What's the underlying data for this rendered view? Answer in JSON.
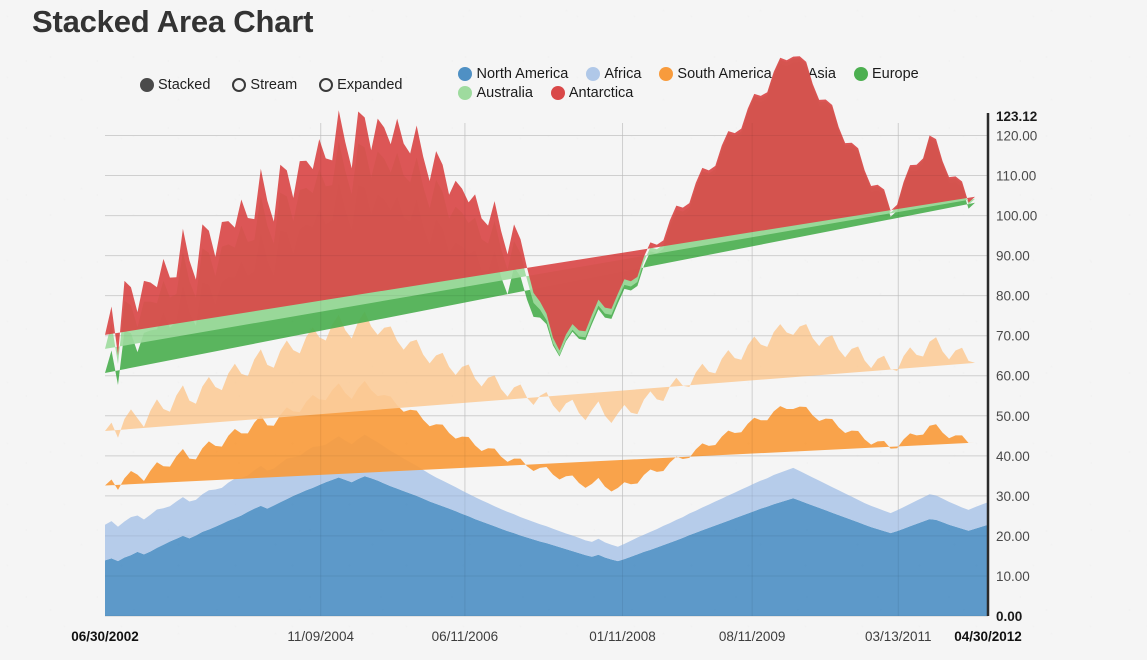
{
  "title": "Stacked Area Chart",
  "controls": {
    "modes": [
      {
        "label": "Stacked",
        "selected": true
      },
      {
        "label": "Stream",
        "selected": false
      },
      {
        "label": "Expanded",
        "selected": false
      }
    ]
  },
  "colors": {
    "background": "#f5f5f5",
    "title": "#333333",
    "gridline": "#dcdcdc",
    "axis": "#2b2b2b",
    "radio_on": "#4a4a4a"
  },
  "chart_data": {
    "type": "area",
    "stacked": true,
    "title": "Stacked Area Chart",
    "xlabel": "",
    "ylabel": "",
    "grid": true,
    "legend_position": "top",
    "ylim": [
      0,
      123.12
    ],
    "yticks": [
      "0.00",
      "10.00",
      "20.00",
      "30.00",
      "40.00",
      "50.00",
      "60.00",
      "70.00",
      "80.00",
      "90.00",
      "100.00",
      "110.00",
      "120.00"
    ],
    "ytick_values": [
      0,
      10,
      20,
      30,
      40,
      50,
      60,
      70,
      80,
      90,
      100,
      110,
      120
    ],
    "ymax_label": "123.12",
    "ymin_label": "0.00",
    "xticks": [
      "06/30/2002",
      "11/09/2004",
      "06/11/2006",
      "01/11/2008",
      "08/11/2009",
      "03/13/2011",
      "04/30/2012"
    ],
    "xtick_positions": [
      0,
      0.2443,
      0.4076,
      0.5861,
      0.7329,
      0.8984,
      1.0
    ],
    "series": [
      {
        "name": "North America",
        "color": "#4f90c4",
        "values": [
          13.9,
          14.4,
          13.7,
          14.6,
          15.2,
          16.0,
          15.4,
          16.1,
          17.0,
          17.8,
          18.6,
          19.3,
          20.0,
          19.4,
          20.1,
          21.0,
          21.6,
          22.3,
          23.0,
          23.8,
          24.4,
          25.1,
          26.0,
          26.8,
          27.5,
          26.8,
          27.6,
          28.4,
          29.2,
          30.0,
          30.7,
          31.4,
          32.0,
          32.7,
          33.4,
          34.0,
          34.6,
          34.0,
          33.4,
          34.2,
          34.9,
          34.4,
          33.8,
          33.1,
          32.4,
          31.8,
          31.2,
          30.6,
          30.0,
          29.3,
          28.6,
          28.0,
          27.4,
          26.8,
          26.2,
          25.5,
          24.9,
          24.2,
          23.6,
          23.0,
          22.4,
          21.8,
          21.2,
          20.7,
          20.1,
          19.6,
          19.1,
          18.6,
          18.2,
          17.7,
          17.2,
          16.7,
          16.2,
          15.7,
          15.2,
          14.8,
          15.3,
          14.6,
          14.1,
          13.7,
          14.2,
          14.8,
          15.4,
          16.0,
          16.5,
          17.1,
          17.7,
          18.3,
          18.9,
          19.5,
          20.2,
          20.8,
          21.4,
          22.0,
          22.6,
          23.2,
          23.8,
          24.4,
          25.0,
          25.6,
          26.2,
          26.8,
          27.3,
          27.9,
          28.4,
          28.9,
          29.4,
          28.8,
          28.2,
          27.6,
          27.0,
          26.4,
          25.8,
          25.2,
          24.6,
          24.0,
          23.4,
          22.8,
          22.2,
          21.7,
          21.2,
          20.7,
          21.2,
          21.8,
          22.4,
          23.0,
          23.6,
          24.2,
          24.0,
          23.4,
          22.8,
          22.3,
          21.8,
          21.3,
          21.8,
          22.3,
          22.8
        ]
      },
      {
        "name": "Africa",
        "color": "#b0c8e8",
        "values": [
          8.9,
          9.3,
          8.6,
          9.0,
          9.5,
          9.1,
          8.7,
          9.2,
          9.6,
          9.1,
          8.8,
          9.3,
          9.7,
          9.2,
          8.9,
          9.4,
          9.8,
          9.3,
          9.0,
          9.5,
          9.9,
          9.4,
          9.1,
          9.6,
          10.0,
          9.5,
          9.2,
          9.7,
          10.1,
          9.6,
          9.3,
          9.8,
          10.2,
          9.7,
          9.4,
          9.9,
          10.3,
          9.8,
          9.5,
          10.0,
          10.4,
          9.9,
          9.6,
          9.2,
          8.8,
          8.5,
          8.1,
          7.8,
          7.5,
          7.2,
          6.9,
          6.6,
          6.4,
          6.2,
          6.0,
          5.8,
          5.6,
          5.5,
          5.3,
          5.2,
          5.0,
          4.9,
          4.8,
          4.7,
          4.6,
          4.5,
          4.4,
          4.3,
          4.2,
          4.1,
          4.0,
          3.9,
          3.9,
          3.8,
          3.7,
          3.7,
          4.0,
          3.8,
          3.7,
          3.6,
          3.8,
          4.0,
          4.2,
          4.3,
          4.5,
          4.6,
          4.8,
          4.9,
          5.1,
          5.2,
          5.4,
          5.5,
          5.7,
          5.8,
          6.0,
          6.1,
          6.3,
          6.4,
          6.6,
          6.7,
          6.9,
          7.0,
          7.1,
          7.3,
          7.4,
          7.5,
          7.6,
          7.4,
          7.2,
          7.0,
          6.8,
          6.6,
          6.4,
          6.2,
          6.0,
          5.8,
          5.6,
          5.4,
          5.3,
          5.2,
          5.1,
          5.0,
          5.2,
          5.4,
          5.6,
          5.8,
          6.0,
          6.2,
          6.1,
          5.9,
          5.7,
          5.5,
          5.3,
          5.2,
          5.4,
          5.5,
          5.6
        ]
      },
      {
        "name": "South America",
        "color": "#f89b3c",
        "values": [
          9.8,
          10.4,
          9.2,
          10.8,
          11.5,
          10.2,
          9.6,
          11.0,
          11.8,
          10.5,
          9.9,
          11.3,
          12.0,
          10.7,
          10.1,
          11.5,
          12.2,
          10.9,
          10.3,
          11.7,
          12.4,
          11.1,
          10.5,
          11.9,
          12.6,
          11.3,
          10.7,
          12.1,
          12.8,
          11.5,
          10.9,
          12.3,
          13.0,
          11.7,
          11.1,
          12.5,
          13.2,
          11.9,
          11.3,
          12.7,
          13.4,
          12.1,
          11.5,
          12.9,
          13.6,
          12.3,
          11.7,
          13.1,
          13.8,
          12.5,
          11.9,
          13.3,
          14.0,
          12.7,
          12.1,
          13.5,
          14.2,
          12.9,
          12.3,
          13.7,
          14.4,
          13.1,
          12.5,
          13.9,
          14.6,
          13.3,
          12.7,
          14.1,
          14.8,
          13.5,
          12.9,
          14.3,
          15.0,
          13.7,
          13.1,
          14.5,
          15.2,
          13.9,
          13.3,
          14.7,
          15.4,
          14.1,
          13.5,
          14.9,
          15.6,
          14.3,
          13.7,
          15.1,
          15.8,
          14.5,
          13.9,
          15.3,
          16.0,
          14.7,
          14.1,
          15.5,
          16.2,
          14.9,
          14.3,
          15.7,
          16.4,
          15.1,
          14.5,
          15.9,
          16.6,
          15.3,
          14.7,
          16.1,
          16.8,
          15.5,
          14.9,
          16.3,
          17.0,
          15.7,
          15.1,
          16.5,
          17.2,
          15.9,
          15.3,
          16.7,
          17.4,
          16.1,
          15.5,
          16.9,
          17.6,
          16.3,
          15.7,
          17.1,
          17.8,
          16.5,
          15.9,
          17.3,
          18.0,
          16.7,
          16.1
        ]
      },
      {
        "name": "Asia",
        "color": "#fbcc9a",
        "values": [
          13.6,
          14.2,
          13.0,
          14.8,
          15.4,
          14.1,
          13.5,
          15.0,
          15.7,
          14.3,
          13.7,
          15.2,
          15.9,
          14.5,
          13.9,
          15.4,
          16.1,
          14.7,
          14.1,
          15.6,
          16.3,
          14.9,
          14.3,
          15.8,
          16.5,
          15.1,
          14.5,
          16.0,
          16.7,
          15.3,
          14.7,
          16.2,
          16.9,
          15.5,
          14.9,
          16.4,
          17.1,
          15.7,
          15.1,
          16.6,
          17.3,
          15.9,
          15.3,
          16.8,
          17.5,
          16.1,
          15.5,
          17.0,
          17.7,
          16.3,
          15.7,
          17.2,
          17.9,
          16.5,
          15.9,
          17.4,
          18.1,
          16.7,
          16.1,
          17.6,
          18.3,
          16.9,
          16.3,
          17.8,
          18.5,
          17.1,
          16.5,
          18.0,
          18.7,
          17.3,
          16.7,
          18.2,
          18.9,
          17.5,
          16.9,
          18.4,
          19.1,
          17.7,
          17.1,
          18.6,
          19.3,
          17.9,
          17.3,
          18.8,
          19.5,
          18.1,
          17.5,
          19.0,
          19.7,
          18.3,
          17.7,
          19.2,
          19.9,
          18.5,
          17.9,
          19.4,
          20.1,
          18.7,
          18.1,
          19.6,
          20.3,
          18.9,
          18.3,
          19.8,
          20.5,
          19.1,
          18.5,
          20.0,
          20.7,
          19.3,
          18.7,
          20.2,
          20.9,
          19.5,
          18.9,
          20.4,
          21.1,
          19.7,
          19.1,
          20.6,
          21.3,
          19.9,
          19.3,
          20.8,
          21.5,
          20.1,
          19.5,
          21.0,
          21.7,
          20.3,
          19.7,
          21.2,
          21.9,
          20.5,
          19.9
        ]
      },
      {
        "name": "Europe",
        "color": "#4caf50",
        "values": [
          14.5,
          18.0,
          13.2,
          22.0,
          19.0,
          16.5,
          23.5,
          20.0,
          17.5,
          24.0,
          21.0,
          18.5,
          25.0,
          22.0,
          19.5,
          26.0,
          23.0,
          20.5,
          27.0,
          24.0,
          21.5,
          28.0,
          25.0,
          22.0,
          29.0,
          26.0,
          23.0,
          30.0,
          27.0,
          24.0,
          31.0,
          28.0,
          25.0,
          32.0,
          29.0,
          26.0,
          33.0,
          30.0,
          27.0,
          34.0,
          31.0,
          28.0,
          35.0,
          32.0,
          29.0,
          36.0,
          33.0,
          30.0,
          35.0,
          32.0,
          29.5,
          34.0,
          31.0,
          28.5,
          33.0,
          30.0,
          27.5,
          32.0,
          29.0,
          26.5,
          31.0,
          28.0,
          25.5,
          30.0,
          27.0,
          24.5,
          22.0,
          19.5,
          17.0,
          15.0,
          14.0,
          15.5,
          17.0,
          18.5,
          20.0,
          21.5,
          23.0,
          24.5,
          26.0,
          27.5,
          29.0,
          30.5,
          32.0,
          33.5,
          35.0,
          36.5,
          38.0,
          39.5,
          41.0,
          42.5,
          44.0,
          45.5,
          47.0,
          48.5,
          50.0,
          51.5,
          53.0,
          54.5,
          56.0,
          57.5,
          59.0,
          60.5,
          62.0,
          63.5,
          65.0,
          66.5,
          68.0,
          66.0,
          64.0,
          62.0,
          60.0,
          58.0,
          56.0,
          54.0,
          52.0,
          50.0,
          48.0,
          46.0,
          44.0,
          42.0,
          40.0,
          38.0,
          40.0,
          42.0,
          44.0,
          46.0,
          48.0,
          50.0,
          48.0,
          46.0,
          44.0,
          42.0,
          40.0,
          38.0,
          40.0,
          42.0,
          44.0
        ]
      },
      {
        "name": "Australia",
        "color": "#9edb9e",
        "values": [
          6.0,
          6.8,
          5.2,
          7.5,
          7.0,
          6.2,
          7.8,
          7.2,
          6.5,
          8.0,
          7.5,
          6.8,
          8.3,
          7.8,
          7.0,
          8.5,
          8.0,
          7.2,
          8.8,
          8.2,
          7.5,
          9.0,
          8.5,
          7.8,
          9.3,
          8.8,
          8.0,
          9.5,
          9.0,
          8.2,
          9.8,
          9.2,
          8.5,
          10.0,
          9.5,
          8.8,
          10.3,
          9.8,
          9.0,
          10.5,
          10.0,
          9.2,
          10.8,
          10.2,
          9.5,
          11.0,
          10.5,
          9.8,
          10.5,
          10.0,
          9.2,
          9.8,
          9.2,
          8.5,
          9.0,
          8.5,
          7.8,
          8.2,
          7.8,
          7.0,
          7.5,
          7.0,
          6.2,
          6.5,
          5.8,
          5.0,
          3.5,
          2.0,
          1.0,
          0.5,
          0.3,
          0.4,
          0.5,
          0.6,
          0.7,
          0.8,
          0.9,
          1.0,
          1.0,
          1.0,
          1.0,
          1.0,
          1.0,
          1.0,
          1.0,
          1.0,
          1.0,
          1.0,
          1.0,
          1.0,
          1.0,
          1.0,
          1.0,
          1.0,
          1.0,
          1.0,
          1.0,
          1.0,
          1.0,
          1.0,
          1.0,
          1.0,
          1.0,
          1.0,
          1.0,
          1.0,
          1.0,
          1.0,
          1.0,
          1.0,
          1.0,
          1.0,
          1.0,
          1.0,
          1.0,
          1.0,
          1.0,
          1.0,
          1.0,
          1.0,
          1.0,
          1.0,
          1.0,
          1.0,
          1.0,
          1.0,
          1.0,
          1.0,
          1.0,
          1.0,
          1.0,
          1.0,
          1.0,
          1.0,
          1.0,
          1.0,
          1.0
        ]
      },
      {
        "name": "Antarctica",
        "color": "#d94848",
        "values": [
          3.5,
          4.2,
          2.2,
          5.0,
          4.5,
          3.8,
          5.2,
          4.8,
          4.0,
          5.5,
          5.0,
          4.2,
          5.8,
          5.2,
          4.5,
          6.0,
          5.5,
          4.8,
          6.2,
          5.8,
          5.0,
          6.5,
          6.0,
          5.2,
          6.8,
          6.2,
          5.5,
          7.0,
          6.5,
          5.8,
          7.2,
          6.8,
          6.0,
          7.5,
          7.0,
          6.2,
          7.8,
          7.2,
          6.5,
          8.0,
          7.5,
          6.8,
          8.2,
          7.8,
          7.0,
          8.5,
          8.0,
          7.2,
          8.0,
          7.5,
          6.8,
          7.2,
          6.8,
          6.0,
          6.5,
          6.0,
          5.2,
          5.8,
          5.2,
          4.5,
          5.0,
          4.5,
          3.8,
          4.2,
          3.5,
          3.0,
          2.5,
          2.0,
          1.6,
          1.4,
          1.2,
          1.3,
          1.4,
          1.5,
          1.5,
          1.5,
          1.5,
          1.5,
          1.5,
          1.4,
          1.4,
          1.3,
          1.3,
          1.2,
          1.2,
          1.1,
          1.1,
          1.0,
          1.0,
          1.0,
          0.9,
          0.9,
          0.9,
          0.8,
          0.8,
          0.8,
          0.7,
          0.7,
          0.7,
          0.6,
          0.6,
          0.6,
          0.6,
          0.5,
          0.5,
          0.5,
          0.5,
          0.5,
          0.5,
          0.5,
          0.5,
          0.5,
          0.5,
          0.5,
          0.5,
          0.5,
          0.5,
          0.5,
          0.5,
          0.5,
          0.5,
          0.5,
          0.5,
          0.5,
          0.5,
          0.5,
          0.5,
          0.5,
          0.5,
          0.5,
          0.5,
          0.5,
          0.5,
          0.5,
          0.5,
          0.5
        ]
      }
    ]
  }
}
